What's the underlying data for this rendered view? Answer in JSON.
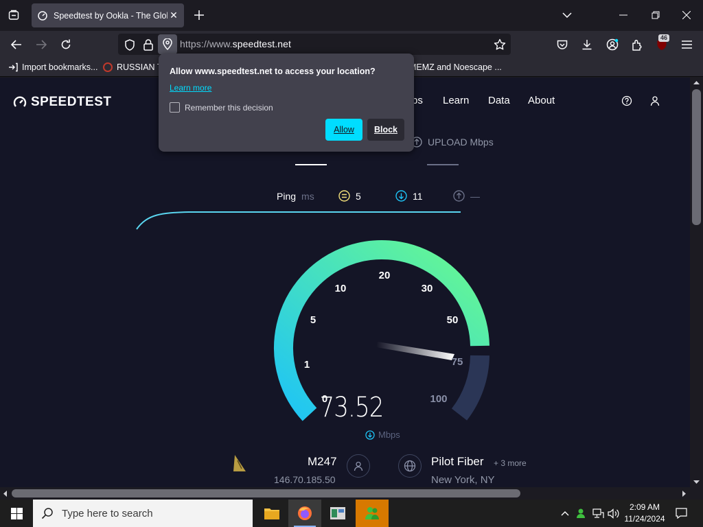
{
  "browser": {
    "tab_title": "Speedtest by Ookla - The Global",
    "url_proto": "https://www.",
    "url_host": "speedtest.net",
    "extension_badge": "46",
    "bookmarks": [
      "Import bookmarks...",
      "RUSSIAN TE",
      "MEMZ and Noescape ..."
    ]
  },
  "popup": {
    "question": "Allow www.speedtest.net to access your location?",
    "learn_more": "Learn more",
    "remember": "Remember this decision",
    "allow": "Allow",
    "block": "Block",
    "accent": "#00ddff"
  },
  "site": {
    "logo": "SPEEDTEST",
    "nav": [
      "ps",
      "Learn",
      "Data",
      "About"
    ],
    "upload_label": "UPLOAD Mbps",
    "ping_label": "Ping",
    "ping_unit": "ms",
    "ping_value": "5",
    "download_ping": "11",
    "upload_ping": "—",
    "gauge_ticks": [
      "0",
      "1",
      "5",
      "10",
      "20",
      "30",
      "50",
      "75",
      "100"
    ],
    "speed": "73.52",
    "speed_unit": "Mbps",
    "isp_name": "M247",
    "isp_ip": "146.70.185.50",
    "server_name": "Pilot Fiber",
    "server_more": "+ 3 more",
    "server_location": "New York, NY",
    "gauge_color_start": "#1ec4f6",
    "gauge_color_end": "#6afa8e"
  },
  "taskbar": {
    "search_placeholder": "Type here to search",
    "time": "2:09 AM",
    "date": "11/24/2024"
  }
}
